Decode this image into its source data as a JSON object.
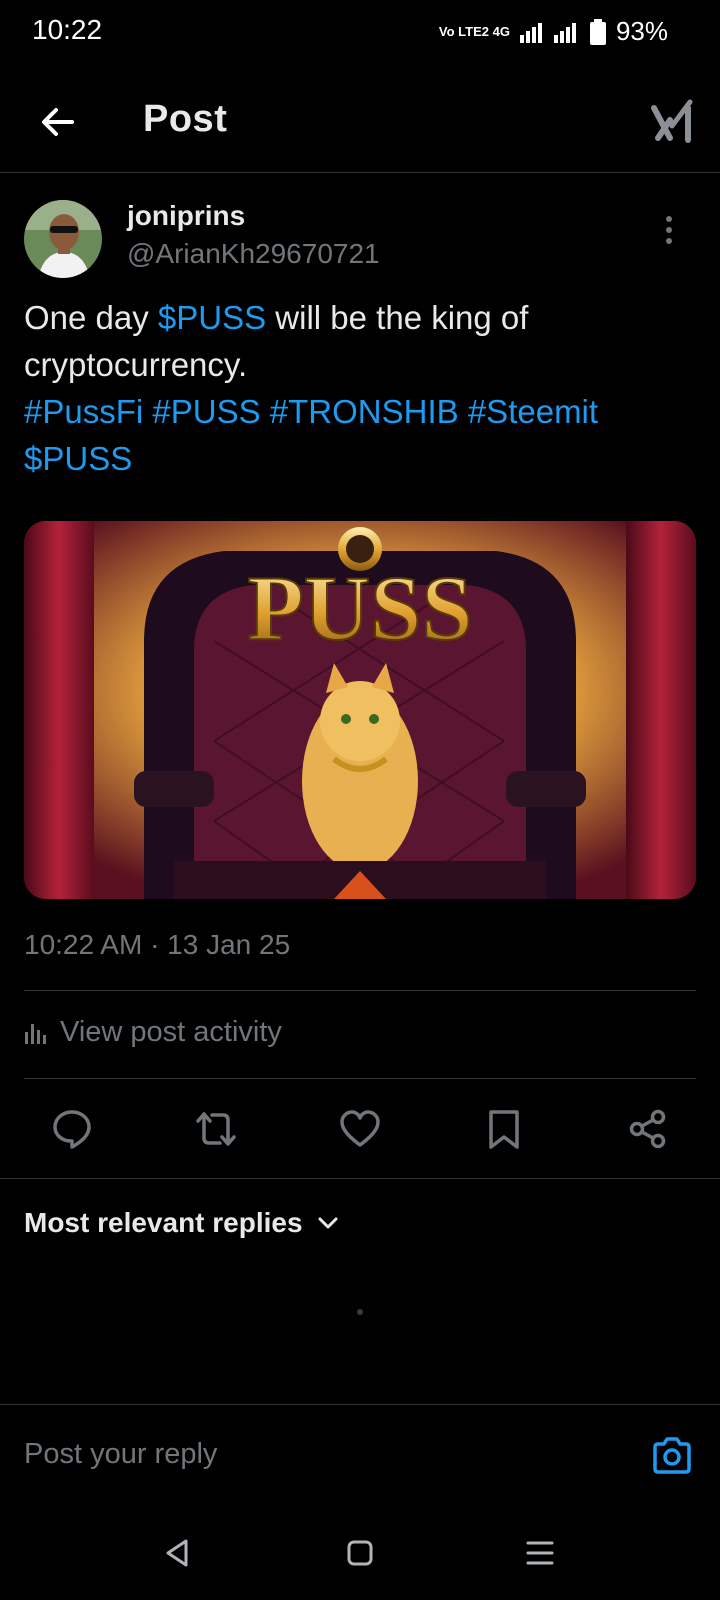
{
  "status_bar": {
    "time": "10:22",
    "network": "Vo LTE2 4G",
    "battery": "93%"
  },
  "header": {
    "title": "Post"
  },
  "post": {
    "author_name": "joniprins",
    "author_handle": "@ArianKh29670721",
    "text_segments": [
      {
        "text": "One day ",
        "link": false
      },
      {
        "text": "$PUSS",
        "link": true
      },
      {
        "text": " will be the king of cryptocurrency.",
        "link": false
      }
    ],
    "hashtags_line": [
      "#PussFi",
      "#PUSS",
      "#TRONSHIB",
      "#Steemit"
    ],
    "cashtag_line": "$PUSS",
    "image": {
      "caption_text": "PUSS"
    },
    "timestamp": "10:22 AM · 13 Jan 25"
  },
  "activity": {
    "label": "View post activity"
  },
  "actions": [
    "reply-icon",
    "repost-icon",
    "like-icon",
    "bookmark-icon",
    "share-icon"
  ],
  "replies": {
    "sort_label": "Most relevant replies"
  },
  "composer": {
    "placeholder": "Post your reply"
  },
  "colors": {
    "background": "#000000",
    "text": "#e7e9ea",
    "secondary": "#71767b",
    "link": "#1d9bf0",
    "divider": "#2f3336"
  }
}
